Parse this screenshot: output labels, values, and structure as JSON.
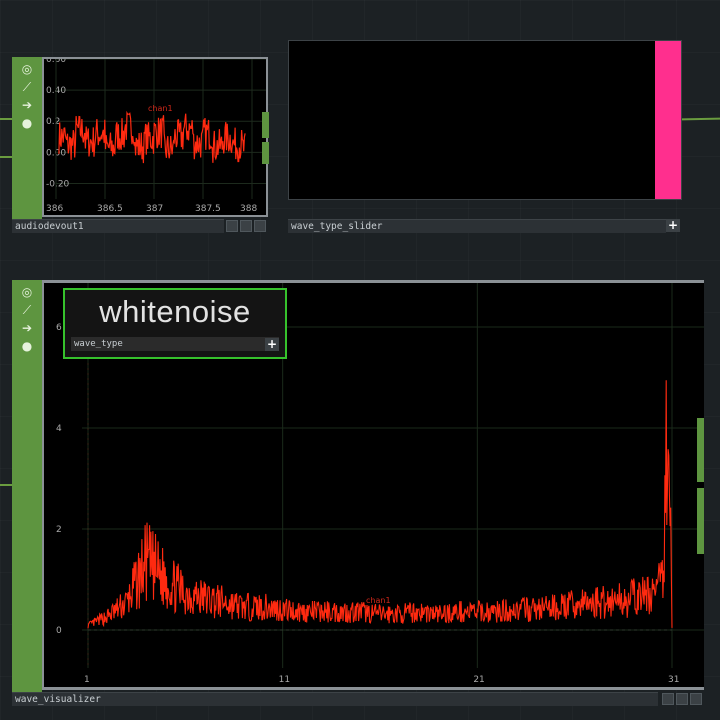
{
  "nodes": {
    "audiodevout": {
      "name": "audiodevout1",
      "chart_label": "chan1",
      "y_ticks": [
        "0.60",
        "0.40",
        "0.2",
        "0.00",
        "-0.20"
      ],
      "x_ticks": [
        "386",
        "386.5",
        "387",
        "387.5",
        "388"
      ]
    },
    "slider": {
      "name": "wave_type_slider",
      "fill_fraction": 0.93,
      "fill_color": "#ff2f8e"
    },
    "visualizer": {
      "name": "wave_visualizer",
      "chart_label": "chan1",
      "y_ticks": [
        "6",
        "4",
        "2",
        "0"
      ],
      "x_ticks": [
        "1",
        "11",
        "21",
        "31"
      ],
      "overlay": {
        "value": "whitenoise",
        "field_label": "wave_type"
      }
    }
  },
  "colors": {
    "accent_green": "#5e9540",
    "signal_red": "#ff2a10",
    "overlay_border": "#36c22c"
  },
  "chart_data": [
    {
      "type": "line",
      "title": "",
      "series": [
        {
          "name": "chan1"
        }
      ],
      "x_range": [
        386,
        388
      ],
      "y_range": [
        -0.3,
        0.6
      ],
      "description_of_shape": "dense noise around 0.08 with amplitude about ±0.12",
      "x": [
        386.0,
        386.1,
        386.2,
        386.3,
        386.4,
        386.5,
        386.6,
        386.7,
        386.8,
        386.9,
        387.0,
        387.1,
        387.2,
        387.3,
        387.4,
        387.5,
        387.6,
        387.7,
        387.8,
        387.9
      ],
      "y": [
        0.1,
        0.05,
        0.14,
        0.07,
        0.12,
        0.03,
        0.11,
        0.16,
        0.04,
        0.09,
        0.13,
        0.02,
        0.1,
        0.15,
        0.06,
        0.12,
        0.04,
        0.09,
        0.05,
        0.02
      ]
    },
    {
      "type": "line",
      "title": "",
      "series": [
        {
          "name": "chan1"
        }
      ],
      "x_range": [
        1,
        31
      ],
      "y_range": [
        -0.5,
        7
      ],
      "x": [
        1,
        2,
        3,
        4,
        5,
        6,
        7,
        8,
        9,
        10,
        11,
        12,
        13,
        14,
        15,
        16,
        17,
        18,
        19,
        20,
        21,
        22,
        23,
        24,
        25,
        26,
        27,
        28,
        29,
        30,
        30.5,
        30.8,
        31
      ],
      "y": [
        0.1,
        0.3,
        0.6,
        1.5,
        1.1,
        0.8,
        0.7,
        0.6,
        0.5,
        0.5,
        0.45,
        0.4,
        0.4,
        0.4,
        0.4,
        0.35,
        0.35,
        0.4,
        0.35,
        0.4,
        0.4,
        0.4,
        0.45,
        0.45,
        0.5,
        0.55,
        0.6,
        0.65,
        0.7,
        0.8,
        1.0,
        5.2,
        0.1
      ]
    }
  ]
}
